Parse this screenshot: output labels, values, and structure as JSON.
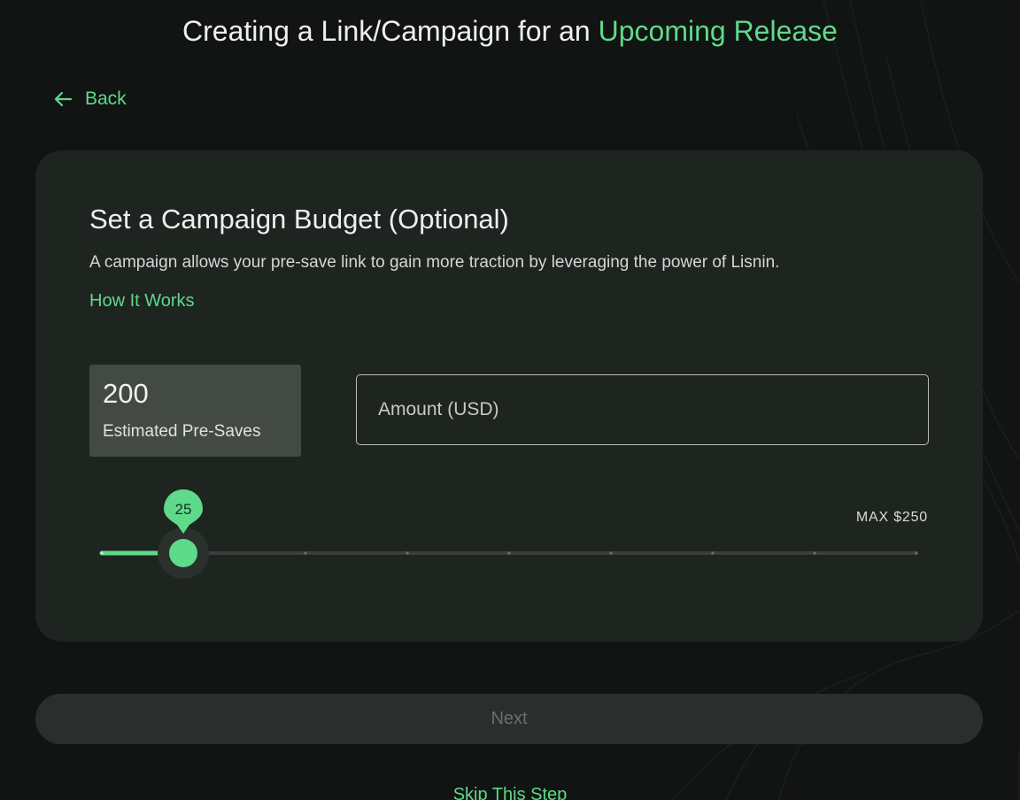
{
  "header": {
    "title_prefix": "Creating a Link/Campaign for an ",
    "title_accent": "Upcoming Release"
  },
  "nav": {
    "back_label": "Back",
    "back_icon": "arrow-left-icon"
  },
  "budget_card": {
    "title": "Set a Campaign Budget (Optional)",
    "description": "A campaign allows your pre-save link to gain more traction by leveraging the power of Lisnin.",
    "how_it_works_label": "How It Works",
    "estimate": {
      "value": "200",
      "label": "Estimated Pre-Saves"
    },
    "amount_input": {
      "placeholder": "Amount (USD)",
      "value": ""
    },
    "slider": {
      "value": 25,
      "value_label": "25",
      "min": 0,
      "max": 250,
      "max_label": "MAX $250"
    }
  },
  "actions": {
    "next_label": "Next",
    "skip_label": "Skip This Step"
  },
  "colors": {
    "accent": "#5fd98a",
    "background": "#121413",
    "card": "#1e2420",
    "estimate_box": "#434a44",
    "button_disabled": "#2b2e2c"
  }
}
